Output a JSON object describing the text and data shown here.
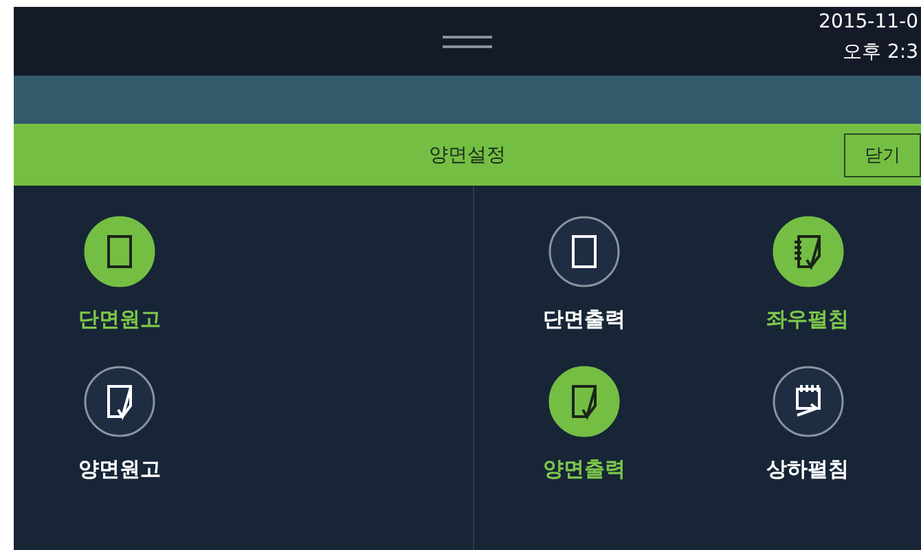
{
  "status_bar": {
    "date": "2015-11-0",
    "time": "오후 2:3"
  },
  "dialog": {
    "title": "양면설정",
    "close_button": "닫기",
    "columns": [
      {
        "options": [
          {
            "kind": "single",
            "label": "단면원고",
            "selected": true
          },
          {
            "kind": "double",
            "label": "양면원고",
            "selected": false
          }
        ]
      },
      {
        "options": [
          {
            "kind": "single",
            "label": "단면출력",
            "selected": false
          },
          {
            "kind": "double",
            "label": "양면출력",
            "selected": true
          }
        ]
      },
      {
        "options": [
          {
            "kind": "side",
            "label": "좌우펼침",
            "selected": true
          },
          {
            "kind": "top",
            "label": "상하펼침",
            "selected": false
          }
        ]
      }
    ]
  }
}
